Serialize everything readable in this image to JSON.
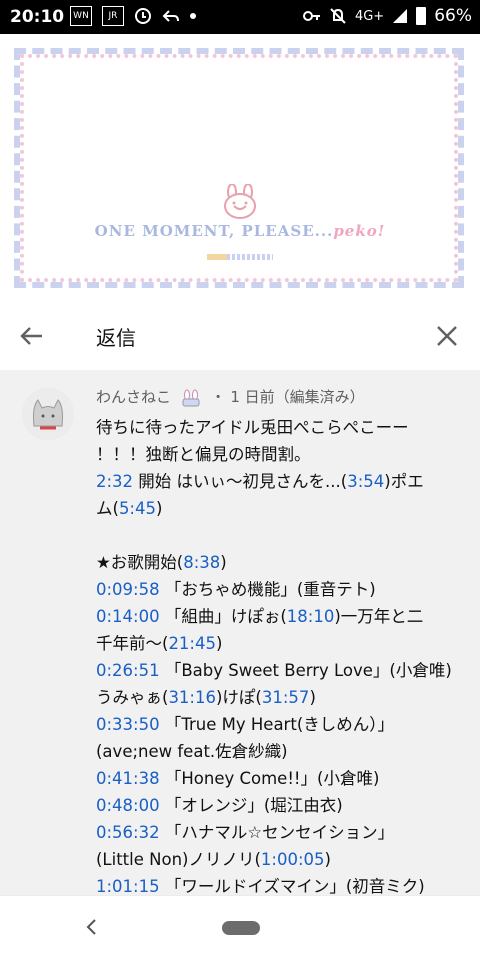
{
  "status": {
    "time": "20:10",
    "network": "4G+",
    "battery": "66%"
  },
  "video": {
    "loading_text_main": "ONE MOMENT, PLEASE...",
    "loading_text_peko": "peko!",
    "loading_progress": 0.3
  },
  "header": {
    "title": "返信"
  },
  "comment": {
    "author": "わんさねこ",
    "meta": "・ 1 日前（編集済み）",
    "lines": [
      [
        {
          "t": "待ちに待ったアイドル兎田ぺこらぺこーー"
        }
      ],
      [
        {
          "t": "！！！独断と偏見の時間割。"
        }
      ],
      [
        {
          "t": "2:32",
          "ts": true
        },
        {
          "t": " 開始 はいぃ〜初見さんを...("
        },
        {
          "t": "3:54",
          "ts": true
        },
        {
          "t": ")ポエ"
        }
      ],
      [
        {
          "t": "ム("
        },
        {
          "t": "5:45",
          "ts": true
        },
        {
          "t": ")"
        }
      ],
      [],
      [
        {
          "t": "★お歌開始("
        },
        {
          "t": "8:38",
          "ts": true
        },
        {
          "t": ")"
        }
      ],
      [
        {
          "t": "0:09:58",
          "ts": true
        },
        {
          "t": " 「おちゃめ機能」(重音テト)"
        }
      ],
      [
        {
          "t": "0:14:00",
          "ts": true
        },
        {
          "t": " 「組曲」けぽぉ("
        },
        {
          "t": "18:10",
          "ts": true
        },
        {
          "t": ")一万年と二"
        }
      ],
      [
        {
          "t": "千年前〜("
        },
        {
          "t": "21:45",
          "ts": true
        },
        {
          "t": ")"
        }
      ],
      [
        {
          "t": "0:26:51",
          "ts": true
        },
        {
          "t": " 「Baby Sweet Berry Love」(小倉唯)"
        }
      ],
      [
        {
          "t": "うみゃぁ("
        },
        {
          "t": "31:16",
          "ts": true
        },
        {
          "t": ")けぽ("
        },
        {
          "t": "31:57",
          "ts": true
        },
        {
          "t": ")"
        }
      ],
      [
        {
          "t": "0:33:50",
          "ts": true
        },
        {
          "t": " 「True My Heart(きしめん）」"
        }
      ],
      [
        {
          "t": "(ave;new feat.佐倉紗織)"
        }
      ],
      [
        {
          "t": "0:41:38",
          "ts": true
        },
        {
          "t": " 「Honey Come!!」(小倉唯)"
        }
      ],
      [
        {
          "t": "0:48:00",
          "ts": true
        },
        {
          "t": " 「オレンジ」(堀江由衣)"
        }
      ],
      [
        {
          "t": "0:56:32",
          "ts": true
        },
        {
          "t": " 「ハナマル☆センセイション」"
        }
      ],
      [
        {
          "t": "(Little Non)ノリノリ("
        },
        {
          "t": "1:00:05",
          "ts": true
        },
        {
          "t": ")"
        }
      ],
      [
        {
          "t": "1:01:15",
          "ts": true
        },
        {
          "t": " 「ワールドイズマイン」(初音ミク)"
        }
      ]
    ]
  },
  "colors": {
    "timestamp": "#1a5fc6",
    "status_bar": "#000000"
  },
  "icons": [
    "back-arrow-icon",
    "close-icon",
    "nav-back-icon"
  ]
}
